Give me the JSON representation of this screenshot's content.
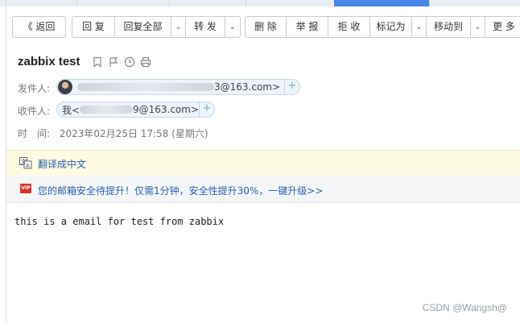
{
  "toolbar": {
    "back": "《 返回",
    "reply": "回 复",
    "reply_all": "回复全部",
    "forward": "转 发",
    "delete": "删 除",
    "report": "举 报",
    "reject": "拒 收",
    "mark_as": "标记为",
    "move_to": "移动到",
    "more": "更 多"
  },
  "mail": {
    "subject": "zabbix test",
    "from_label": "发件人:",
    "from_address_suffix": "3@163.com>",
    "to_label": "收件人:",
    "to_prefix": "我<",
    "to_address_suffix": "9@163.com>",
    "time_label": "时　间:",
    "time_value": "2023年02月25日 17:58 (星期六)",
    "body": "this is a email for test from zabbix"
  },
  "translate": {
    "label": "翻译成中文"
  },
  "promo": {
    "badge": "VIP",
    "text": "您的邮箱安全待提升！仅需1分钟，安全性提升30%，一键升级>>"
  },
  "watermark": "CSDN @Wangsh@",
  "icons": [
    "bookmark-icon",
    "flag-icon",
    "clock-icon",
    "print-icon",
    "translate-icon",
    "vip-icon",
    "plus-icon",
    "chevron-down-icon"
  ],
  "colors": {
    "link": "#2a62b3",
    "translate_bg": "#fdfbe2",
    "vip": "#d8322d",
    "active_tab": "#4a86e8"
  }
}
